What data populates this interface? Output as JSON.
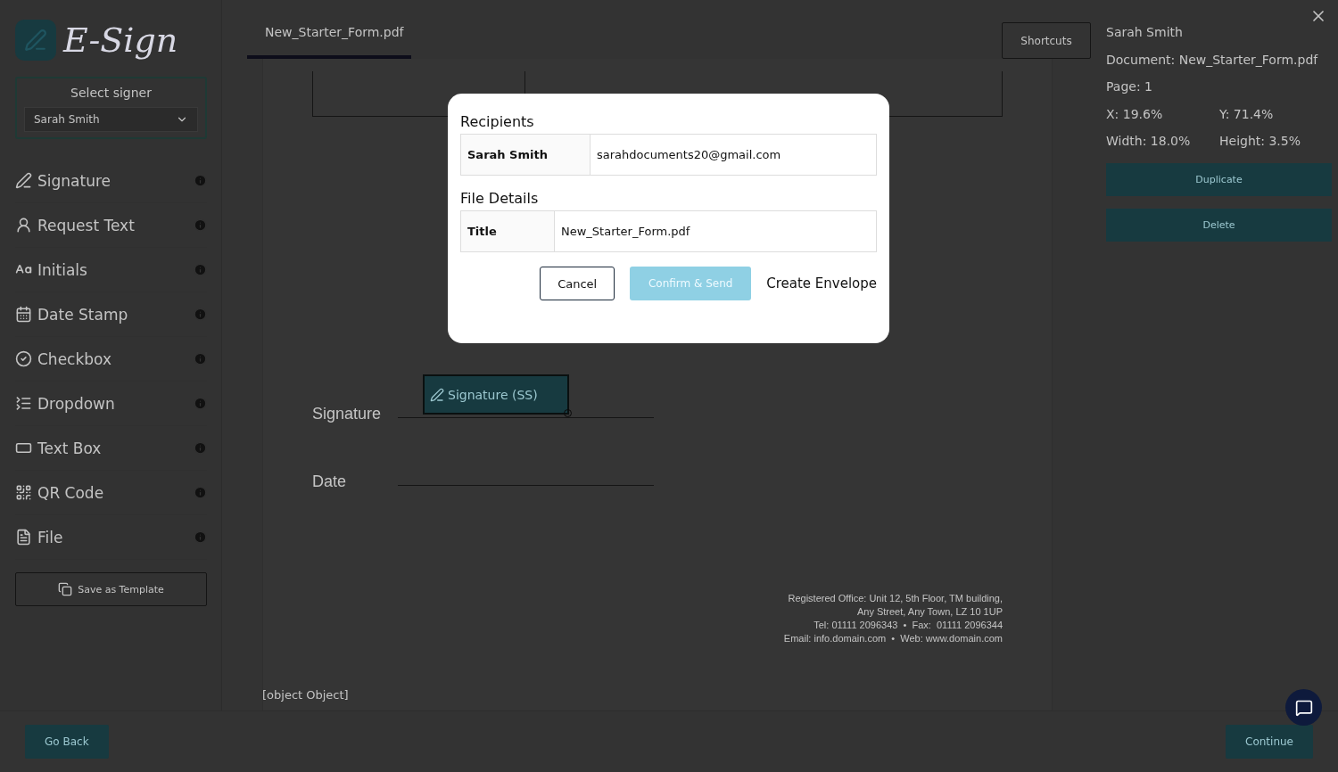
{
  "logo": {
    "text": "E-Sign"
  },
  "signer_select": {
    "label": "Select signer",
    "value": "Sarah Smith"
  },
  "tools": [
    {
      "label": "Signature",
      "kind": "signature"
    },
    {
      "label": "Request Text",
      "kind": "request-text"
    },
    {
      "label": "Initials",
      "kind": "initials"
    },
    {
      "label": "Date Stamp",
      "kind": "date-stamp"
    },
    {
      "label": "Checkbox",
      "kind": "checkbox"
    },
    {
      "label": "Dropdown",
      "kind": "dropdown"
    },
    {
      "label": "Text Box",
      "kind": "text-box"
    },
    {
      "label": "QR Code",
      "kind": "qr-code"
    },
    {
      "label": "File",
      "kind": "file"
    }
  ],
  "save_template_button": "Save as Template",
  "tabs": [
    {
      "label": "New_Starter_Form.pdf",
      "selected": true
    }
  ],
  "shortcuts_button": "Shortcuts",
  "document": {
    "fields": [
      {
        "label": "Signature",
        "placed": "Signature (SS)"
      },
      {
        "label": "Date"
      }
    ],
    "footer_lines": [
      "Registered Office: Unit 12, 5th Floor, TM building,",
      "Any Street, Any Town, LZ 10 1UP",
      "Tel: 01111 2096343  •  Fax:  01111 2096344",
      "Email: info.domain.com  •  Web: www.domain.com"
    ],
    "trailing_text": "[object Object]"
  },
  "properties": {
    "signer": "Sarah Smith",
    "document": "Document: New_Starter_Form.pdf",
    "page": "Page: 1",
    "x": "X: 19.6%",
    "y": "Y: 71.4%",
    "width": "Width: 18.0%",
    "height": "Height: 3.5%",
    "buttons": [
      "Duplicate",
      "Delete"
    ]
  },
  "modal": {
    "recipients_heading": "Recipients",
    "recipients": [
      {
        "name": "Sarah Smith",
        "email": "sarahdocuments20@gmail.com"
      }
    ],
    "file_heading": "File Details",
    "file_rows": [
      {
        "label": "Title",
        "value": "New_Starter_Form.pdf"
      }
    ],
    "cancel": "Cancel",
    "confirm": {
      "label": "Confirm & Send",
      "disabled": true
    },
    "title": "Create Envelope"
  },
  "bottom": {
    "back": "Go Back",
    "continue": "Continue"
  }
}
